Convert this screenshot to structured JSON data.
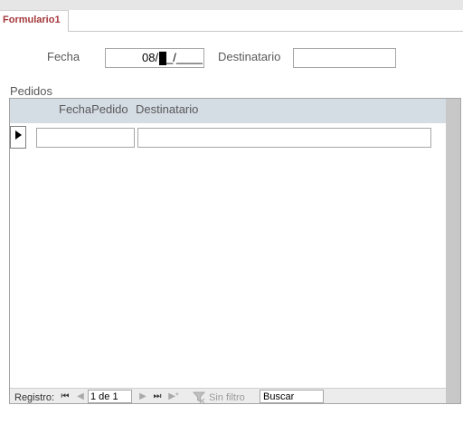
{
  "tab": {
    "label": "Formulario1"
  },
  "form": {
    "fecha_label": "Fecha",
    "fecha_value": "08/",
    "fecha_mask_rest": "_/____",
    "destinatario_label": "Destinatario",
    "destinatario_value": ""
  },
  "subform": {
    "label": "Pedidos",
    "columns": [
      "FechaPedido",
      "Destinatario"
    ],
    "new_row": {
      "fecha_pedido": "",
      "destinatario": ""
    }
  },
  "navigation": {
    "record_label": "Registro:",
    "position": "1 de 1",
    "first_icon": "first-record-icon",
    "prev_icon": "previous-record-icon",
    "next_icon": "next-record-icon",
    "last_icon": "last-record-icon",
    "new_icon": "new-record-icon",
    "filter_label": "Sin filtro",
    "search_placeholder": "Buscar"
  },
  "colors": {
    "tab_text": "#a4373a",
    "subform_header": "#d4dce4"
  }
}
